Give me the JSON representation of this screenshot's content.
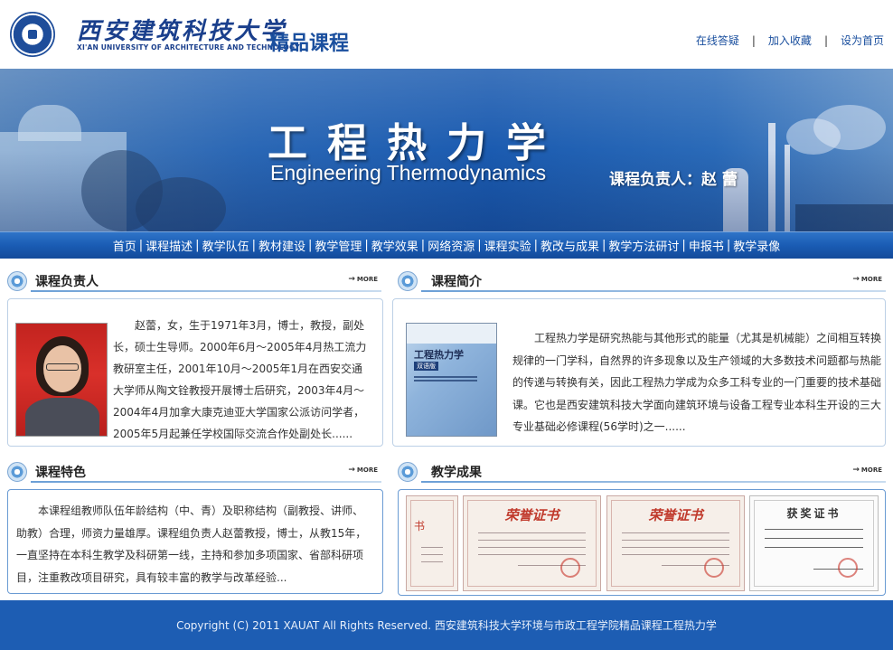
{
  "header": {
    "logo_cn": "西安建筑科技大学",
    "logo_en": "XI'AN UNIVERSITY OF ARCHITECTURE AND TECHNOLOGY",
    "site_title": "精品课程",
    "links": [
      "在线答疑",
      "加入收藏",
      "设为首页"
    ]
  },
  "banner": {
    "title_cn": "工程热力学",
    "title_en": "Engineering Thermodynamics",
    "lead": "课程负责人：赵 蕾"
  },
  "nav": {
    "items": [
      "首页",
      "课程描述",
      "教学队伍",
      "教材建设",
      "教学管理",
      "教学效果",
      "网络资源",
      "课程实验",
      "教改与成果",
      "教学方法研讨",
      "申报书",
      "教学录像"
    ]
  },
  "panels": {
    "leader": {
      "title": "课程负责人",
      "more": "MORE",
      "text": "赵蕾，女，生于1971年3月，博士，教授，副处长，硕士生导师。2000年6月～2005年4月热工流力教研室主任，2001年10月～2005年1月在西安交通大学师从陶文铨教授开展博士后研究，2003年4月～2004年4月加拿大康克迪亚大学国家公派访问学者，2005年5月起兼任学校国际交流合作处副处长......"
    },
    "intro": {
      "title": "课程简介",
      "more": "MORE",
      "book_title": "工程热力学",
      "book_sub": "双语版",
      "text": "工程热力学是研究热能与其他形式的能量（尤其是机械能）之间相互转换规律的一门学科，自然界的许多现象以及生产领域的大多数技术问题都与热能的传递与转换有关，因此工程热力学成为众多工科专业的一门重要的技术基础课。它也是西安建筑科技大学面向建筑环境与设备工程专业本科生开设的三大专业基础必修课程(56学时)之一......"
    },
    "features": {
      "title": "课程特色",
      "more": "MORE",
      "text": "本课程组教师队伍年龄结构（中、青）及职称结构（副教授、讲师、助教）合理，师资力量雄厚。课程组负责人赵蕾教授，博士，从教15年，一直坚持在本科生教学及科研第一线，主持和参加多项国家、省部科研项目，注重教改项目研究，具有较丰富的教学与改革经验..."
    },
    "achievements": {
      "title": "教学成果",
      "more": "MORE",
      "certs": [
        "书",
        "荣誉证书",
        "荣誉证书",
        "获奖证书"
      ]
    }
  },
  "footer": {
    "text": "Copyright (C) 2011 XAUAT All Rights Reserved. 西安建筑科技大学环境与市政工程学院精品课程工程热力学"
  },
  "colors": {
    "brand_blue": "#1a4f9e",
    "nav_blue": "#1a5cb4",
    "footer_blue": "#1d5db3"
  }
}
